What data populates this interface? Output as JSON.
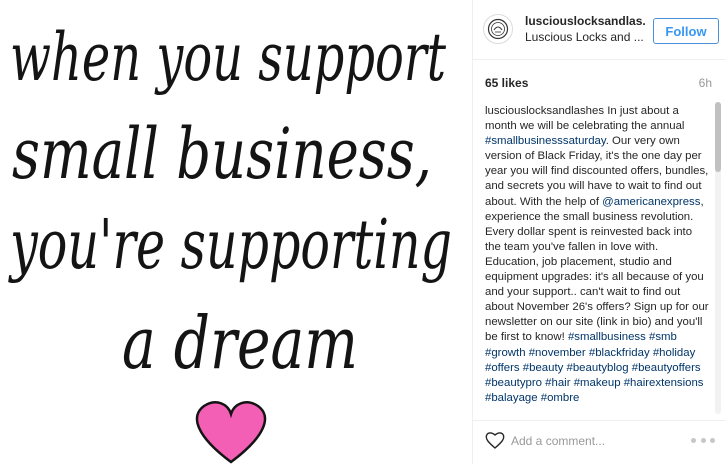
{
  "post_image": {
    "lines": [
      "when you support",
      "small business,",
      "you're supporting",
      "a dream"
    ],
    "heart_color": "#f25fb4",
    "ink_color": "#141414"
  },
  "header": {
    "username": "lusciouslocksandlas...",
    "subtitle": "Luscious Locks and ...",
    "follow_label": "Follow",
    "avatar_icon": "brand-logo-icon"
  },
  "meta": {
    "likes": "65 likes",
    "time": "6h"
  },
  "caption": {
    "author": "lusciouslocksandlashes",
    "segments": [
      {
        "t": " In just about a month we will be celebrating the annual ",
        "k": "text"
      },
      {
        "t": "#smallbusinesssaturday",
        "k": "tag"
      },
      {
        "t": ". Our very own version of Black Friday, it's the one day per year you will find discounted offers, bundles, and secrets you will have to wait to find out about. With the help of ",
        "k": "text"
      },
      {
        "t": "@americanexpress",
        "k": "tag"
      },
      {
        "t": ", experience the small business revolution. Every dollar spent is reinvested back into the team you've fallen in love with. Education, job placement, studio and equipment upgrades: it's all because of you and your support.. can't wait to find out about November 26's offers? Sign up for our newsletter on our site (link in bio) and you'll be first to know! ",
        "k": "text"
      },
      {
        "t": "#smallbusiness",
        "k": "tag"
      },
      {
        "t": " ",
        "k": "text"
      },
      {
        "t": "#smb",
        "k": "tag"
      },
      {
        "t": " ",
        "k": "text"
      },
      {
        "t": "#growth",
        "k": "tag"
      },
      {
        "t": " ",
        "k": "text"
      },
      {
        "t": "#november",
        "k": "tag"
      },
      {
        "t": " ",
        "k": "text"
      },
      {
        "t": "#blackfriday",
        "k": "tag"
      },
      {
        "t": " ",
        "k": "text"
      },
      {
        "t": "#holiday",
        "k": "tag"
      },
      {
        "t": " ",
        "k": "text"
      },
      {
        "t": "#offers",
        "k": "tag"
      },
      {
        "t": " ",
        "k": "text"
      },
      {
        "t": "#beauty",
        "k": "tag"
      },
      {
        "t": " ",
        "k": "text"
      },
      {
        "t": "#beautyblog",
        "k": "tag"
      },
      {
        "t": " ",
        "k": "text"
      },
      {
        "t": "#beautyoffers",
        "k": "tag"
      },
      {
        "t": " ",
        "k": "text"
      },
      {
        "t": "#beautypro",
        "k": "tag"
      },
      {
        "t": " ",
        "k": "text"
      },
      {
        "t": "#hair",
        "k": "tag"
      },
      {
        "t": " ",
        "k": "text"
      },
      {
        "t": "#makeup",
        "k": "tag"
      },
      {
        "t": " ",
        "k": "text"
      },
      {
        "t": "#hairextensions",
        "k": "tag"
      },
      {
        "t": " ",
        "k": "text"
      },
      {
        "t": "#balayage",
        "k": "tag"
      },
      {
        "t": " ",
        "k": "text"
      },
      {
        "t": "#ombre",
        "k": "tag"
      }
    ]
  },
  "comment_bar": {
    "placeholder": "Add a comment...",
    "like_icon": "heart-outline-icon",
    "more_icon": "more-options-icon"
  },
  "colors": {
    "accent": "#3897f0",
    "hashtag": "#003569"
  }
}
